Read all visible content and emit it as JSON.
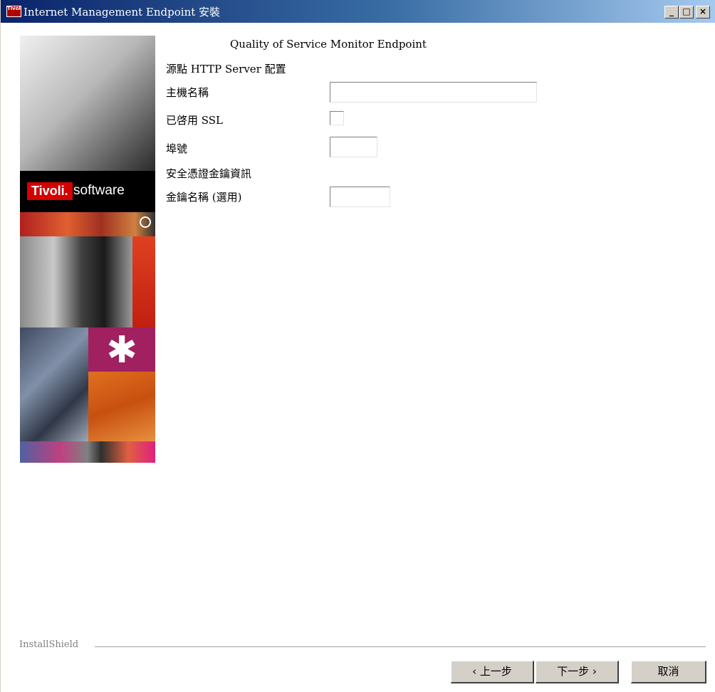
{
  "window": {
    "title": "Internet Management Endpoint 安裝",
    "app_icon_text": "Tivoli",
    "controls": {
      "minimize": "_",
      "maximize": "□",
      "close": "×"
    }
  },
  "sidebar": {
    "brand_logo": "Tivoli.",
    "brand_text": "software"
  },
  "form": {
    "heading": "Quality of Service Monitor Endpoint",
    "http_section_label": "源點 HTTP Server 配置",
    "hostname_label": "主機名稱",
    "hostname_value": "",
    "ssl_label": "已啓用 SSL",
    "ssl_checked": false,
    "port_label": "埠號",
    "port_value": "",
    "security_section_label": "安全憑證金鑰資訊",
    "key_name_label": "金鑰名稱 (選用)",
    "key_name_value": ""
  },
  "footer": {
    "installshield": "InstallShield",
    "back_button": "‹ 上一步",
    "next_button": "下一步 ›",
    "cancel_button": "取消"
  }
}
